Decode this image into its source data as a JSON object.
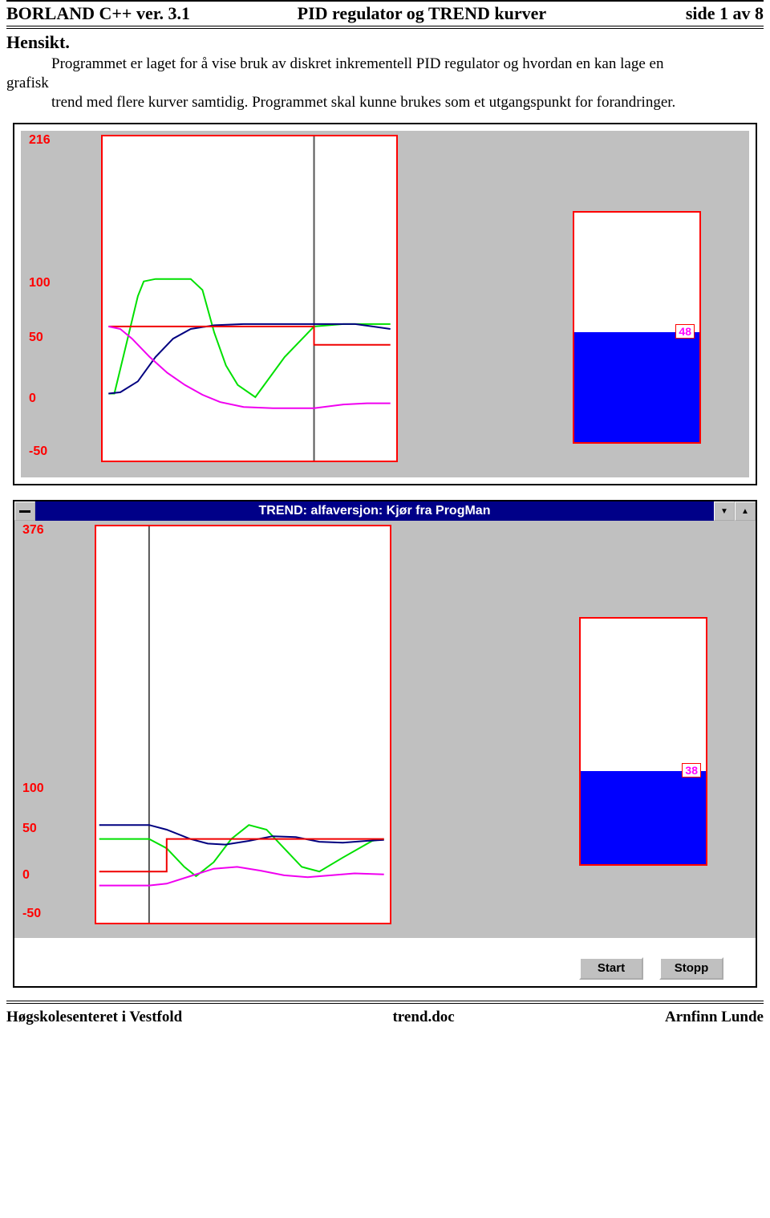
{
  "header": {
    "left": "BORLAND C++ ver. 3.1",
    "center": "PID regulator og TREND kurver",
    "right": "side 1 av 8"
  },
  "section_title": "Hensikt.",
  "paragraph": {
    "line1": "Programmet er laget for å vise bruk av  diskret inkrementell PID regulator og hvordan en kan lage en",
    "word": "grafisk",
    "line2": "trend med flere kurver samtidig.  Programmet skal kunne brukes som et utgangspunkt for forandringer."
  },
  "window": {
    "title": "TREND: alfaversjon: Kjør fra ProgMan",
    "start": "Start",
    "stop": "Stopp"
  },
  "footer": {
    "left": "Høgskolesenteret i Vestfold",
    "center": "trend.doc",
    "right": "Arnfinn Lunde"
  },
  "chart_data": [
    {
      "type": "line",
      "ylim": [
        -50,
        216
      ],
      "yticks": [
        -50,
        0,
        50,
        100,
        216
      ],
      "cursor_x": 0.72,
      "tank_level": 48,
      "tank_max": 100,
      "series": [
        {
          "name": "green",
          "color": "#00e000",
          "values": [
            [
              0.02,
              0.05
            ],
            [
              0.04,
              0.05
            ],
            [
              0.08,
              0.45
            ],
            [
              0.12,
              0.85
            ],
            [
              0.14,
              0.97
            ],
            [
              0.18,
              0.99
            ],
            [
              0.24,
              0.99
            ],
            [
              0.3,
              0.99
            ],
            [
              0.34,
              0.9
            ],
            [
              0.38,
              0.55
            ],
            [
              0.42,
              0.28
            ],
            [
              0.46,
              0.12
            ],
            [
              0.52,
              0.02
            ],
            [
              0.62,
              0.35
            ],
            [
              0.72,
              0.6
            ],
            [
              0.82,
              0.62
            ],
            [
              0.9,
              0.62
            ],
            [
              0.98,
              0.62
            ]
          ]
        },
        {
          "name": "navy",
          "color": "#000080",
          "values": [
            [
              0.02,
              0.05
            ],
            [
              0.06,
              0.06
            ],
            [
              0.12,
              0.15
            ],
            [
              0.18,
              0.35
            ],
            [
              0.24,
              0.5
            ],
            [
              0.3,
              0.58
            ],
            [
              0.38,
              0.61
            ],
            [
              0.48,
              0.62
            ],
            [
              0.58,
              0.62
            ],
            [
              0.72,
              0.62
            ],
            [
              0.86,
              0.62
            ],
            [
              0.92,
              0.6
            ],
            [
              0.98,
              0.58
            ]
          ]
        },
        {
          "name": "red-sp",
          "color": "#f00000",
          "values": [
            [
              0.02,
              0.6
            ],
            [
              0.72,
              0.6
            ],
            [
              0.72,
              0.45
            ],
            [
              0.98,
              0.45
            ]
          ]
        },
        {
          "name": "magenta",
          "color": "#f000f0",
          "values": [
            [
              0.02,
              0.6
            ],
            [
              0.06,
              0.58
            ],
            [
              0.1,
              0.5
            ],
            [
              0.16,
              0.35
            ],
            [
              0.22,
              0.22
            ],
            [
              0.28,
              0.12
            ],
            [
              0.34,
              0.04
            ],
            [
              0.4,
              -0.02
            ],
            [
              0.48,
              -0.06
            ],
            [
              0.58,
              -0.07
            ],
            [
              0.72,
              -0.07
            ],
            [
              0.82,
              -0.04
            ],
            [
              0.9,
              -0.03
            ],
            [
              0.98,
              -0.03
            ]
          ]
        }
      ]
    },
    {
      "type": "line",
      "ylim": [
        -50,
        376
      ],
      "yticks": [
        -50,
        0,
        50,
        100,
        376
      ],
      "cursor_x": 0.18,
      "tank_level": 38,
      "tank_max": 100,
      "series": [
        {
          "name": "green",
          "color": "#00e000",
          "values": [
            [
              0.01,
              0.4
            ],
            [
              0.12,
              0.4
            ],
            [
              0.18,
              0.4
            ],
            [
              0.24,
              0.3
            ],
            [
              0.3,
              0.1
            ],
            [
              0.34,
              0.0
            ],
            [
              0.4,
              0.15
            ],
            [
              0.46,
              0.4
            ],
            [
              0.52,
              0.55
            ],
            [
              0.58,
              0.5
            ],
            [
              0.64,
              0.3
            ],
            [
              0.7,
              0.1
            ],
            [
              0.76,
              0.05
            ],
            [
              0.84,
              0.2
            ],
            [
              0.94,
              0.38
            ],
            [
              0.98,
              0.4
            ]
          ]
        },
        {
          "name": "navy",
          "color": "#000080",
          "values": [
            [
              0.01,
              0.55
            ],
            [
              0.1,
              0.55
            ],
            [
              0.18,
              0.55
            ],
            [
              0.24,
              0.5
            ],
            [
              0.32,
              0.4
            ],
            [
              0.38,
              0.35
            ],
            [
              0.44,
              0.34
            ],
            [
              0.52,
              0.38
            ],
            [
              0.6,
              0.43
            ],
            [
              0.68,
              0.42
            ],
            [
              0.76,
              0.37
            ],
            [
              0.84,
              0.36
            ],
            [
              0.92,
              0.38
            ],
            [
              0.98,
              0.39
            ]
          ]
        },
        {
          "name": "red-sp",
          "color": "#f00000",
          "values": [
            [
              0.01,
              0.05
            ],
            [
              0.24,
              0.05
            ],
            [
              0.24,
              0.4
            ],
            [
              0.98,
              0.4
            ]
          ]
        },
        {
          "name": "magenta",
          "color": "#f000f0",
          "values": [
            [
              0.01,
              -0.1
            ],
            [
              0.1,
              -0.1
            ],
            [
              0.18,
              -0.1
            ],
            [
              0.24,
              -0.08
            ],
            [
              0.32,
              0.0
            ],
            [
              0.4,
              0.08
            ],
            [
              0.48,
              0.1
            ],
            [
              0.56,
              0.06
            ],
            [
              0.64,
              0.01
            ],
            [
              0.72,
              -0.01
            ],
            [
              0.8,
              0.01
            ],
            [
              0.88,
              0.03
            ],
            [
              0.98,
              0.02
            ]
          ]
        }
      ]
    }
  ]
}
